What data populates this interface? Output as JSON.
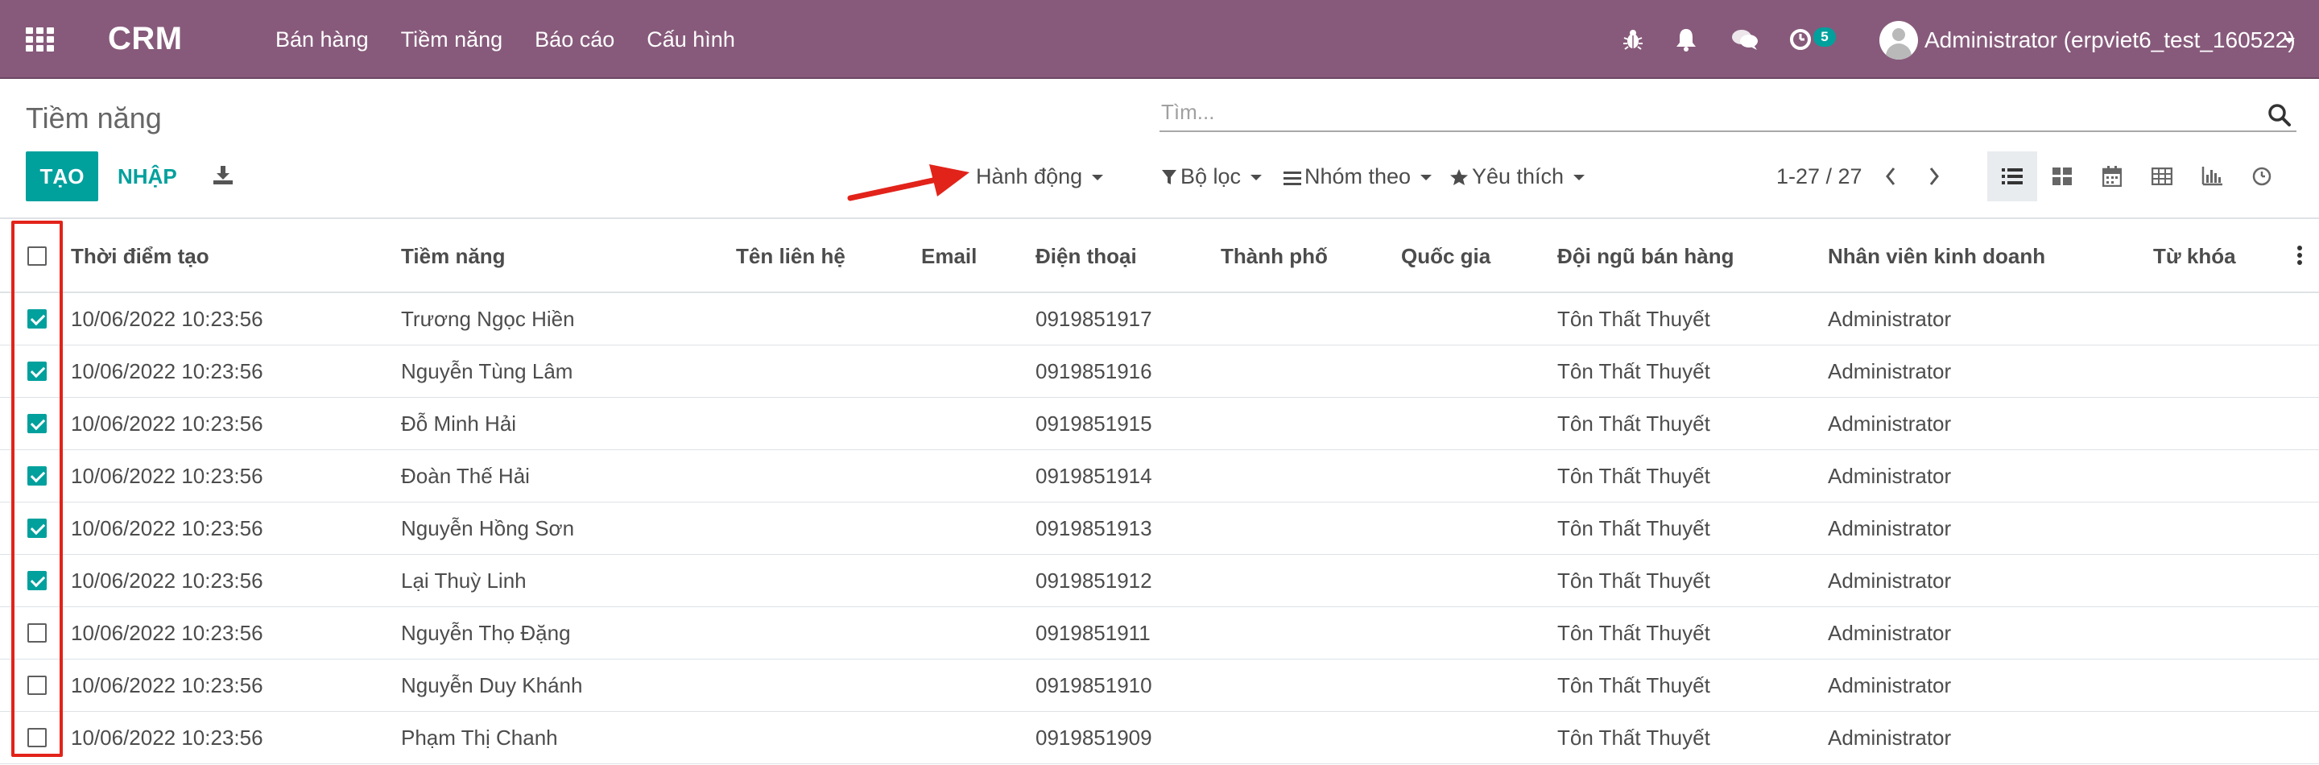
{
  "navbar": {
    "brand": "CRM",
    "menu": [
      "Bán hàng",
      "Tiềm năng",
      "Báo cáo",
      "Cấu hình"
    ],
    "activities_badge": "5",
    "user": "Administrator (erpviet6_test_160522)",
    "icons": [
      "apps-grid-icon",
      "bug-icon",
      "bell-icon",
      "chat-icon",
      "clock-activity-icon"
    ]
  },
  "control_panel": {
    "title": "Tiềm năng",
    "search_placeholder": "Tìm...",
    "create_label": "TẠO",
    "import_label": "NHẬP",
    "action_label": "Hành động",
    "filter_label": "Bộ lọc",
    "group_label": "Nhóm theo",
    "favorites_label": "Yêu thích",
    "pager": "1-27 / 27",
    "views": [
      "list-view-icon",
      "kanban-view-icon",
      "calendar-view-icon",
      "pivot-view-icon",
      "graph-view-icon",
      "activity-view-icon"
    ],
    "active_view": "list-view-icon",
    "colors": {
      "navbar": "#875a7b",
      "primary": "#00a09d",
      "annotation": "#e2231a"
    }
  },
  "table": {
    "columns": [
      "Thời điểm tạo",
      "Tiềm năng",
      "Tên liên hệ",
      "Email",
      "Điện thoại",
      "Thành phố",
      "Quốc gia",
      "Đội ngũ bán hàng",
      "Nhân viên kinh doanh",
      "Từ khóa"
    ],
    "rows": [
      {
        "checked": true,
        "created": "10/06/2022 10:23:56",
        "lead": "Trương Ngọc Hiền",
        "contact": "",
        "email": "",
        "phone": "0919851917",
        "city": "",
        "country": "",
        "team": "Tôn Thất Thuyết",
        "salesperson": "Administrator",
        "tags": ""
      },
      {
        "checked": true,
        "created": "10/06/2022 10:23:56",
        "lead": "Nguyễn Tùng Lâm",
        "contact": "",
        "email": "",
        "phone": "0919851916",
        "city": "",
        "country": "",
        "team": "Tôn Thất Thuyết",
        "salesperson": "Administrator",
        "tags": ""
      },
      {
        "checked": true,
        "created": "10/06/2022 10:23:56",
        "lead": "Đỗ Minh Hải",
        "contact": "",
        "email": "",
        "phone": "0919851915",
        "city": "",
        "country": "",
        "team": "Tôn Thất Thuyết",
        "salesperson": "Administrator",
        "tags": ""
      },
      {
        "checked": true,
        "created": "10/06/2022 10:23:56",
        "lead": "Đoàn Thế Hải",
        "contact": "",
        "email": "",
        "phone": "0919851914",
        "city": "",
        "country": "",
        "team": "Tôn Thất Thuyết",
        "salesperson": "Administrator",
        "tags": ""
      },
      {
        "checked": true,
        "created": "10/06/2022 10:23:56",
        "lead": "Nguyễn Hồng Sơn",
        "contact": "",
        "email": "",
        "phone": "0919851913",
        "city": "",
        "country": "",
        "team": "Tôn Thất Thuyết",
        "salesperson": "Administrator",
        "tags": ""
      },
      {
        "checked": true,
        "created": "10/06/2022 10:23:56",
        "lead": "Lại Thuỳ Linh",
        "contact": "",
        "email": "",
        "phone": "0919851912",
        "city": "",
        "country": "",
        "team": "Tôn Thất Thuyết",
        "salesperson": "Administrator",
        "tags": ""
      },
      {
        "checked": false,
        "created": "10/06/2022 10:23:56",
        "lead": "Nguyễn Thọ Đặng",
        "contact": "",
        "email": "",
        "phone": "0919851911",
        "city": "",
        "country": "",
        "team": "Tôn Thất Thuyết",
        "salesperson": "Administrator",
        "tags": ""
      },
      {
        "checked": false,
        "created": "10/06/2022 10:23:56",
        "lead": "Nguyễn Duy Khánh",
        "contact": "",
        "email": "",
        "phone": "0919851910",
        "city": "",
        "country": "",
        "team": "Tôn Thất Thuyết",
        "salesperson": "Administrator",
        "tags": ""
      },
      {
        "checked": false,
        "created": "10/06/2022 10:23:56",
        "lead": "Phạm Thị Chanh",
        "contact": "",
        "email": "",
        "phone": "0919851909",
        "city": "",
        "country": "",
        "team": "Tôn Thất Thuyết",
        "salesperson": "Administrator",
        "tags": ""
      }
    ]
  }
}
